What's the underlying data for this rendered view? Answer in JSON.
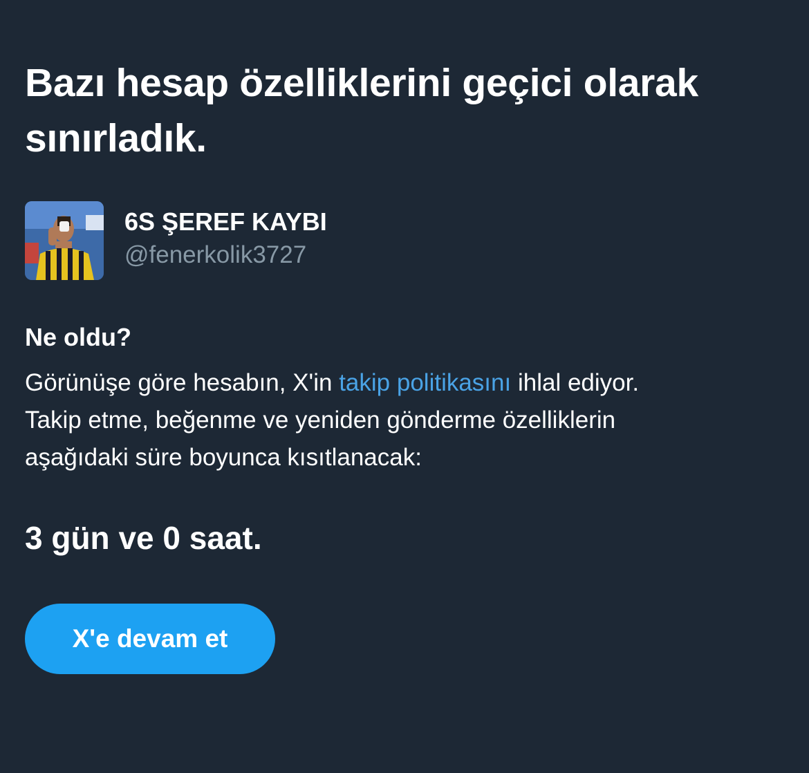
{
  "header": {
    "title": "Bazı hesap özelliklerini geçici olarak sınırladık."
  },
  "account": {
    "display_name": "6S ŞEREF KAYBI",
    "handle": "@fenerkolik3727",
    "avatar_icon": "profile-photo-icon"
  },
  "details": {
    "heading": "Ne oldu?",
    "text_before_link": "Görünüşe göre hesabın, X'in ",
    "link_text": "takip politikasını",
    "text_after_link": " ihlal ediyor.",
    "line2": "Takip etme, beğenme ve yeniden gönderme özelliklerin",
    "line3": "aşağıdaki süre boyunca kısıtlanacak:"
  },
  "restriction": {
    "duration": "3 gün ve 0 saat."
  },
  "actions": {
    "continue_label": "X'e devam et"
  },
  "colors": {
    "background": "#1d2835",
    "link": "#4aa3e6",
    "button": "#1da1f2",
    "secondary_text": "#8899a6"
  }
}
